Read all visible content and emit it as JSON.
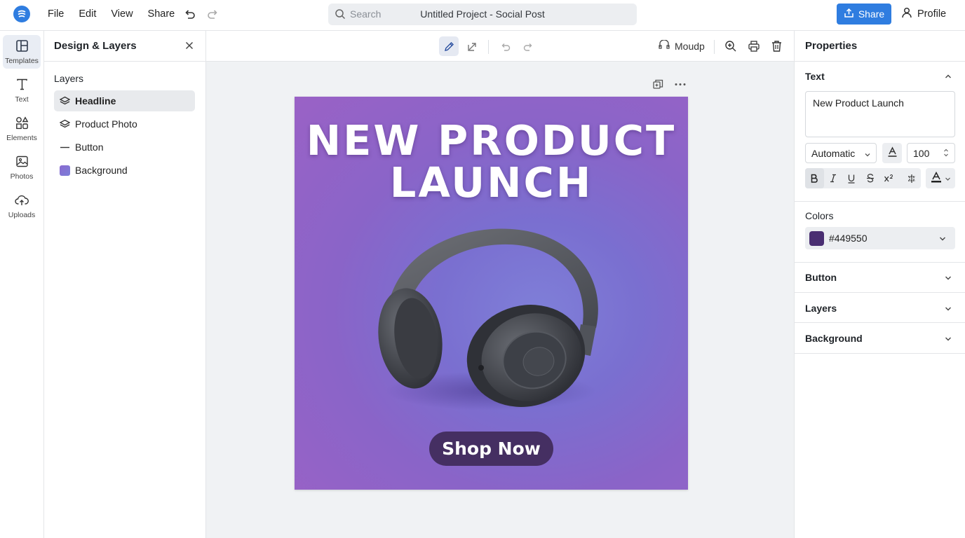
{
  "topbar": {
    "menu": [
      "File",
      "Edit",
      "View",
      "Share"
    ],
    "search_placeholder": "Search",
    "project_title": "Untitled Project - Social Post",
    "share_label": "Share",
    "profile_label": "Profile"
  },
  "rail": {
    "items": [
      {
        "label": "Templates",
        "icon": "templates-icon"
      },
      {
        "label": "Text",
        "icon": "text-icon"
      },
      {
        "label": "Elements",
        "icon": "elements-icon"
      },
      {
        "label": "Photos",
        "icon": "photos-icon"
      },
      {
        "label": "Uploads",
        "icon": "uploads-icon"
      }
    ]
  },
  "layers_panel": {
    "title": "Design & Layers",
    "section_label": "Layers",
    "layers": [
      {
        "label": "Headline",
        "icon": "layers-icon",
        "active": true
      },
      {
        "label": "Product Photo",
        "icon": "layers-icon",
        "active": false
      },
      {
        "label": "Button",
        "icon": "line-icon",
        "active": false
      },
      {
        "label": "Background",
        "icon": "color-swatch-icon",
        "active": false
      }
    ]
  },
  "canvas_toolbar": {
    "mockup_label": "Moudp"
  },
  "artboard": {
    "headline_line1": "NEW PRODUCT",
    "headline_line2": "LAUNCH",
    "cta_label": "Shop Now"
  },
  "properties": {
    "title": "Properties",
    "text_section": "Text",
    "text_value": "New Product Launch",
    "font_value": "Automatic",
    "size_value": "100",
    "colors_section": "Colors",
    "color_hex": "#449550",
    "sections": [
      "Button",
      "Layers",
      "Background"
    ]
  },
  "colors": {
    "accent": "#2f7de0",
    "cta_bg": "#452f62",
    "swatch": "#4a2e72"
  }
}
